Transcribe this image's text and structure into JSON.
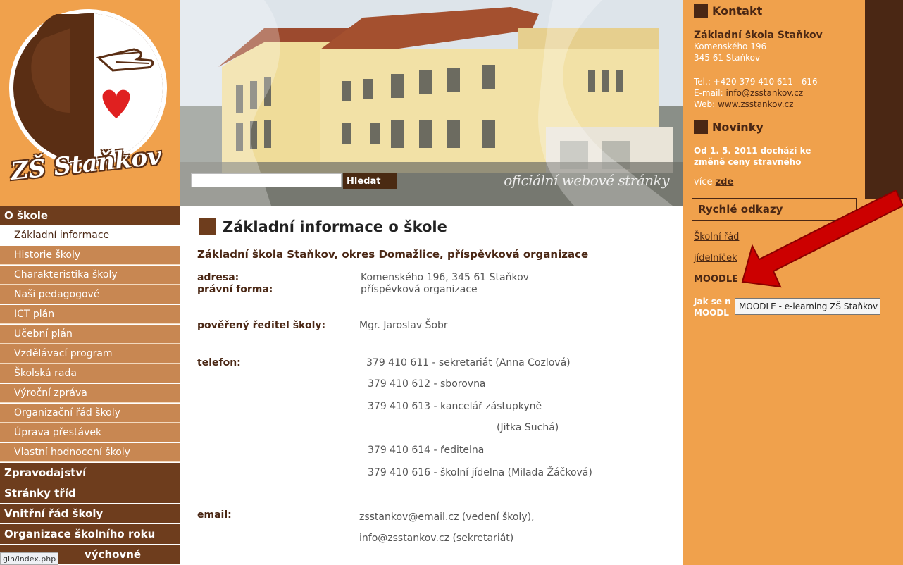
{
  "logo": {
    "brand": "ZŠ Staňkov"
  },
  "search": {
    "button": "Hledat",
    "placeholder": ""
  },
  "banner": {
    "tagline": "oficiální webové stránky"
  },
  "nav": {
    "section1": "O škole",
    "sub_items": [
      "Základní informace",
      "Historie školy",
      "Charakteristika školy",
      "Naši pedagogové",
      "ICT plán",
      "Učební plán",
      "Vzdělávací program",
      "Školská rada",
      "Výroční zpráva",
      "Organizační řád školy",
      "Úprava přestávek",
      "Vlastní hodnocení školy"
    ],
    "sections": [
      "Zpravodajství",
      "Stránky tříd",
      "Vnitřní řád školy",
      "Organizace školního roku"
    ],
    "partial_last": "výchovné"
  },
  "status_bar": {
    "url": "gin/index.php"
  },
  "main": {
    "title": "Základní informace o škole",
    "subtitle": "Základní škola Staňkov, okres Domažlice, příspěvková organizace",
    "labels": {
      "adresa": "adresa:",
      "pravni": "právní forma:",
      "reditel": "pověřený ředitel školy:",
      "telefon": "telefon:",
      "email": "email:"
    },
    "values": {
      "adresa": "Komenského 196, 345 61 Staňkov",
      "pravni": "příspěvková organizace",
      "reditel": "Mgr. Jaroslav Šobr",
      "phones": [
        "379 410 611 - sekretariát (Anna Cozlová)",
        "379 410 612 - sborovna",
        "379 410 613 - kancelář zástupkyně",
        "(Jitka Suchá)",
        "379 410 614 - ředitelna",
        "379 410 616 - školní jídelna (Milada Žáčková)"
      ],
      "emails": [
        "zsstankov@email.cz (vedení školy),",
        "info@zsstankov.cz (sekretariát)"
      ]
    }
  },
  "side": {
    "kontakt_title": "Kontakt",
    "school_name": "Základní škola Staňkov",
    "street": "Komenského 196",
    "city": "345 61 Staňkov",
    "tel": "Tel.: +420 379 410 611 - 616",
    "email_label": "E-mail: ",
    "email": "info@zsstankov.cz",
    "web_label": "Web: ",
    "web": "www.zsstankov.cz",
    "novinky_title": "Novinky",
    "novinky_text": "Od 1. 5. 2011 dochází ke změně ceny stravného",
    "more_label": "více ",
    "more_link": "zde",
    "rychle_title": "Rychlé odkazy",
    "links": [
      "Školní řád",
      "jídelníček",
      "MOODLE"
    ],
    "partial_text_1": "Jak se n",
    "partial_text_2": "MOODL",
    "tooltip": "MOODLE - e-learning ZŠ Staňkov"
  },
  "colors": {
    "brown": "#4a2714",
    "orange": "#f0a14c",
    "nav_sub": "#c88752",
    "arrow": "#cc0000"
  }
}
